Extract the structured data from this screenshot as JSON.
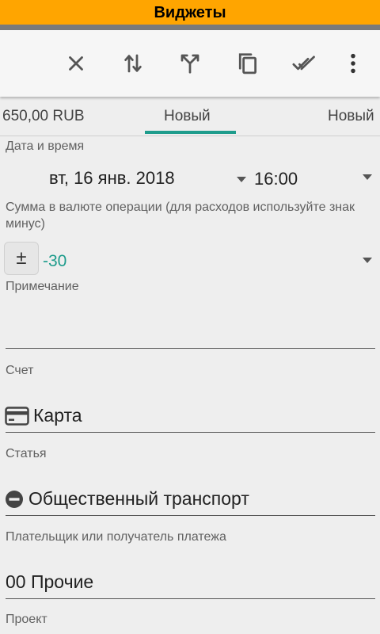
{
  "title_bar": {
    "title": "Виджеты"
  },
  "toolbar": {
    "icons": [
      "close-icon",
      "swap-vert-icon",
      "call-split-icon",
      "copy-icon",
      "done-all-icon",
      "more-vert-icon"
    ]
  },
  "tabs": [
    {
      "label": "650,00 RUB",
      "active": false
    },
    {
      "label": "Новый",
      "active": true
    },
    {
      "label": "Новый",
      "active": false
    }
  ],
  "form": {
    "datetime": {
      "label": "Дата и время",
      "date": "вт, 16 янв. 2018",
      "time": "16:00"
    },
    "amount": {
      "label": "Сумма в валюте операции (для расходов используйте знак минус)",
      "sign": "±",
      "value": "-30"
    },
    "note": {
      "label": "Примечание",
      "value": ""
    },
    "account": {
      "label": "Счет",
      "value": "Карта",
      "icon": "credit-card-icon"
    },
    "category": {
      "label": "Статья",
      "value": "Общественный транспорт",
      "icon": "minus-circle-icon"
    },
    "payee": {
      "label": "Плательщик или получатель платежа",
      "value": "00 Прочие"
    },
    "project": {
      "label": "Проект"
    }
  },
  "colors": {
    "accent": "#1e9c8c",
    "title_bar": "#ffa500"
  }
}
